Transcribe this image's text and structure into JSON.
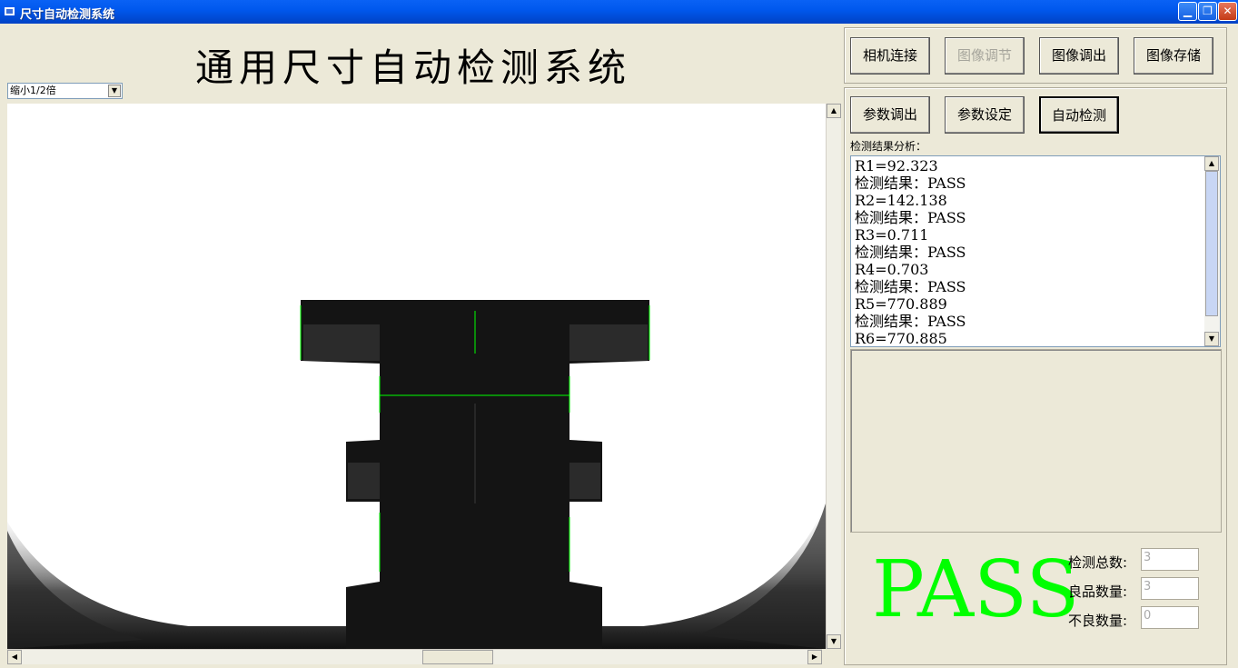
{
  "window": {
    "title": "尺寸自动检测系统"
  },
  "heading": "通用尺寸自动检测系统",
  "zoom": {
    "selected": "缩小1/2倍"
  },
  "camera_buttons": {
    "connect": "相机连接",
    "adjust": "图像调节",
    "load": "图像调出",
    "save": "图像存储"
  },
  "param_buttons": {
    "load": "参数调出",
    "set": "参数设定",
    "auto": "自动检测"
  },
  "result_label": "检测结果分析：",
  "result_lines": [
    "R1=92.323",
    "检测结果：PASS",
    "R2=142.138",
    "检测结果：PASS",
    "R3=0.711",
    "检测结果：PASS",
    "R4=0.703",
    "检测结果：PASS",
    "R5=770.889",
    "检测结果：PASS",
    "R6=770.885"
  ],
  "verdict": "PASS",
  "verdict_color": "#00ff00",
  "stats": {
    "total_label": "检测总数:",
    "total": "3",
    "good_label": "良品数量:",
    "good": "3",
    "bad_label": "不良数量:",
    "bad": "0"
  }
}
